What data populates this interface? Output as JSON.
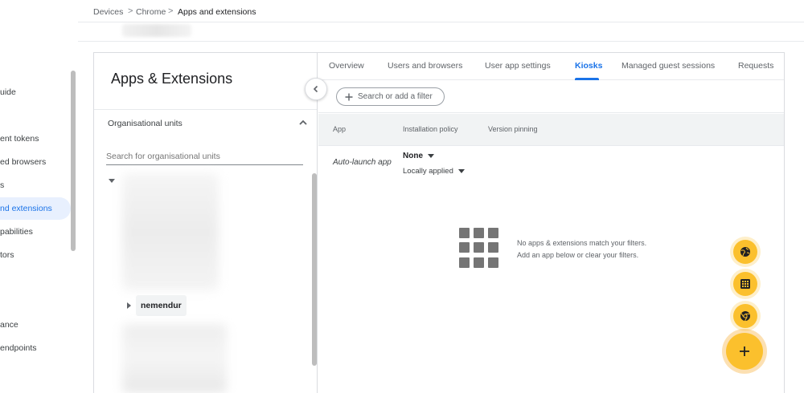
{
  "nav": {
    "items": [
      {
        "label": "uide",
        "active": false
      },
      {
        "label": "ent tokens",
        "active": false
      },
      {
        "label": "ed browsers",
        "active": false
      },
      {
        "label": "s",
        "active": false
      },
      {
        "label": "nd extensions",
        "active": true
      },
      {
        "label": "pabilities",
        "active": false
      },
      {
        "label": "tors",
        "active": false
      },
      {
        "label": "ance",
        "active": false
      },
      {
        "label": "endpoints",
        "active": false
      }
    ]
  },
  "breadcrumb": {
    "items": [
      "Devices",
      "Chrome",
      "Apps and extensions"
    ],
    "separator": ">"
  },
  "panel": {
    "title": "Apps & Extensions",
    "org_units_label": "Organisational units",
    "search_placeholder": "Search for organisational units",
    "selected_unit": "nemendur"
  },
  "tabs": [
    {
      "label": "Overview",
      "active": false
    },
    {
      "label": "Users and browsers",
      "active": false
    },
    {
      "label": "User app settings",
      "active": false
    },
    {
      "label": "Kiosks",
      "active": true
    },
    {
      "label": "Managed guest sessions",
      "active": false
    },
    {
      "label": "Requests",
      "active": false
    }
  ],
  "filter": {
    "label": "Search or add a filter"
  },
  "table": {
    "headers": [
      "App",
      "Installation policy",
      "Version pinning"
    ],
    "row": {
      "app": "Auto-launch app",
      "policy": "None",
      "policy_sub": "Locally applied"
    }
  },
  "empty_state": {
    "line1": "No apps & extensions match your filters.",
    "line2": "Add an app below or clear your filters."
  },
  "fabs": {
    "items": [
      {
        "icon": "globe-icon"
      },
      {
        "icon": "grid-apps-icon"
      },
      {
        "icon": "chrome-icon"
      }
    ],
    "main_icon": "plus-icon",
    "color": "#fbc02d"
  },
  "colors": {
    "accent": "#1a73e8",
    "active_nav_bg": "#e8f0fe"
  }
}
